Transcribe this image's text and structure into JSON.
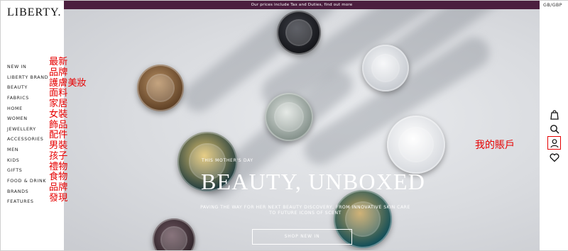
{
  "brand": {
    "logo_text": "LIBERTY."
  },
  "banner": {
    "text": "Our prices include Tax and Duties, find out more"
  },
  "locale": {
    "label": "GB/GBP"
  },
  "nav": {
    "items": [
      {
        "label": "NEW IN"
      },
      {
        "label": "LIBERTY BRAND"
      },
      {
        "label": "BEAUTY"
      },
      {
        "label": "FABRICS"
      },
      {
        "label": "HOME"
      },
      {
        "label": "WOMEN"
      },
      {
        "label": "JEWELLERY"
      },
      {
        "label": "ACCESSORIES"
      },
      {
        "label": "MEN"
      },
      {
        "label": "KIDS"
      },
      {
        "label": "GIFTS"
      },
      {
        "label": "FOOD & DRINK"
      },
      {
        "label": "BRANDS"
      },
      {
        "label": "FEATURES"
      }
    ]
  },
  "annotations": {
    "nav_translations": [
      "最新",
      "品牌",
      "護膚美妝",
      "面料",
      "家居",
      "女裝",
      "飾品",
      "配件",
      "男裝",
      "孩子",
      "禮物",
      "食物",
      "品牌",
      "發現"
    ],
    "account_label": "我的賬戶",
    "highlight_color": "#e60000"
  },
  "icons": {
    "bag": "shopping-bag-icon",
    "search": "search-icon",
    "account": "account-icon",
    "wishlist": "heart-icon"
  },
  "hero": {
    "kicker": "THIS MOTHER'S DAY",
    "title": "BEAUTY, UNBOXED",
    "description": "PAVING THE WAY FOR HER NEXT BEAUTY DISCOVERY, FROM INNOVATIVE SKIN CARE TO FUTURE ICONS OF SCENT",
    "cta_label": "SHOP NEW IN"
  },
  "colors": {
    "banner_bg": "#4b1f3f",
    "annotation": "#e60000"
  }
}
